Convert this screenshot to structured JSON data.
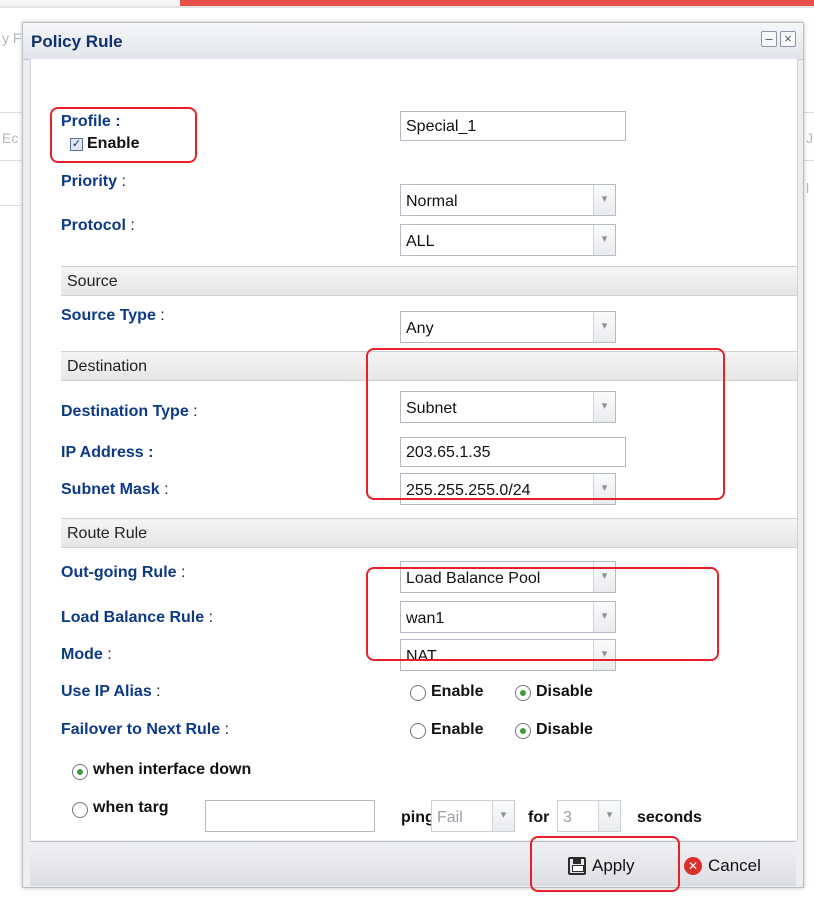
{
  "dialog": {
    "title": "Policy Rule",
    "minimize_icon": "minimize-icon",
    "close_icon": "close-icon"
  },
  "form": {
    "profile": {
      "label": "Profile :",
      "value": "Special_1"
    },
    "enable": {
      "label": "Enable",
      "checked": true
    },
    "priority": {
      "label": "Priority",
      "value": "Normal"
    },
    "protocol": {
      "label": "Protocol",
      "value": "ALL"
    },
    "sections": {
      "source": "Source",
      "destination": "Destination",
      "route_rule": "Route Rule"
    },
    "source_type": {
      "label": "Source Type",
      "value": "Any"
    },
    "destination_type": {
      "label": "Destination Type",
      "value": "Subnet"
    },
    "ip_address": {
      "label": "IP Address :",
      "value": "203.65.1.35"
    },
    "subnet_mask": {
      "label": "Subnet Mask",
      "value": "255.255.255.0/24"
    },
    "outgoing_rule": {
      "label": "Out-going Rule",
      "value": "Load Balance Pool"
    },
    "load_balance_rule": {
      "label": "Load Balance Rule",
      "value": "wan1"
    },
    "mode": {
      "label": "Mode",
      "value": "NAT"
    },
    "use_ip_alias": {
      "label": "Use IP Alias",
      "enable": "Enable",
      "disable": "Disable",
      "selected": "Disable"
    },
    "failover": {
      "label": "Failover to Next Rule",
      "enable": "Enable",
      "disable": "Disable",
      "selected": "Disable"
    },
    "when_interface_down": "when interface down",
    "when_target": "when targ",
    "ping_label": "ping",
    "ping_value": "Fail",
    "for_label": "for",
    "for_value": "3",
    "seconds_label": "seconds"
  },
  "colon": ":",
  "footer": {
    "apply": "Apply",
    "cancel": "Cancel"
  },
  "background": {
    "glyph_left": "y F",
    "glyph_mid": "Ec",
    "glyph_right1": "J",
    "glyph_right2": "l"
  },
  "colors": {
    "label": "#0c3a85",
    "highlight": "#e8202a",
    "radio_dot": "#3d9b3d",
    "title": "#10306e"
  }
}
